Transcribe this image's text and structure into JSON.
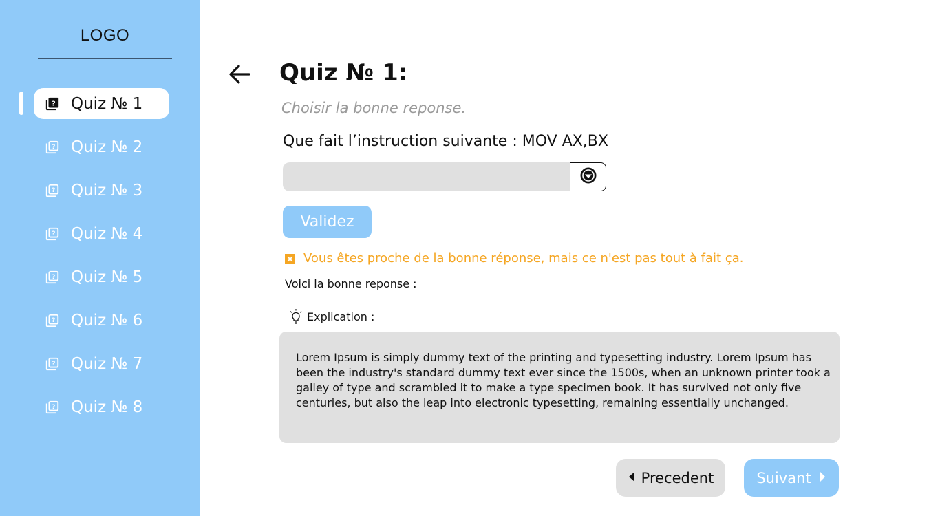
{
  "sidebar": {
    "logo": "LOGO",
    "items": [
      {
        "label": "Quiz № 1",
        "icon": "quiz-book-icon",
        "active": true
      },
      {
        "label": "Quiz № 2",
        "icon": "quiz-book-icon",
        "active": false
      },
      {
        "label": "Quiz № 3",
        "icon": "quiz-book-icon",
        "active": false
      },
      {
        "label": "Quiz № 4",
        "icon": "quiz-book-icon",
        "active": false
      },
      {
        "label": "Quiz № 5",
        "icon": "quiz-book-icon",
        "active": false
      },
      {
        "label": "Quiz № 6",
        "icon": "quiz-book-icon",
        "active": false
      },
      {
        "label": "Quiz № 7",
        "icon": "quiz-book-icon",
        "active": false
      },
      {
        "label": "Quiz № 8",
        "icon": "quiz-book-icon",
        "active": false
      }
    ]
  },
  "main": {
    "title": "Quiz № 1:",
    "subtitle": "Choisir la bonne reponse.",
    "question": "Que fait l’instruction suivante : MOV AX,BX",
    "answer_value": "",
    "validate_label": "Validez",
    "feedback": "Vous êtes proche de la bonne réponse, mais ce n'est pas tout à fait ça.",
    "correct_label": "Voici la bonne reponse :",
    "explication_label": "Explication :",
    "explanation": "Lorem Ipsum is simply dummy text of the printing and typesetting industry. Lorem Ipsum has been the industry's standard dummy text ever since the 1500s, when an unknown printer took a galley of type and scrambled it to make a type specimen book. It has survived not only five centuries, but also the leap into electronic typesetting, remaining essentially unchanged.",
    "prev_label": "Precedent",
    "next_label": "Suivant"
  },
  "colors": {
    "sidebar_bg": "#90caf9",
    "accent": "#90caf9",
    "warning": "#f5a623",
    "muted_bg": "#e0e0e0"
  }
}
